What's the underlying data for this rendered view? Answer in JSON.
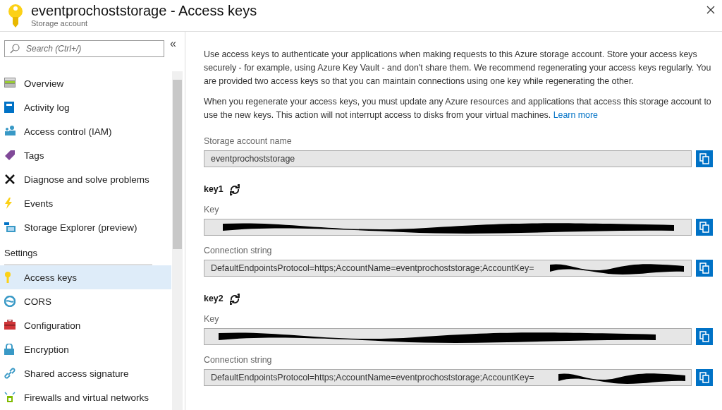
{
  "header": {
    "title": "eventprochoststorage - Access keys",
    "subtitle": "Storage account"
  },
  "sidebar": {
    "search": {
      "placeholder": "Search (Ctrl+/)"
    },
    "collapse": "«",
    "items": [
      {
        "label": "Overview",
        "selected": false
      },
      {
        "label": "Activity log",
        "selected": false
      },
      {
        "label": "Access control (IAM)",
        "selected": false
      },
      {
        "label": "Tags",
        "selected": false
      },
      {
        "label": "Diagnose and solve problems",
        "selected": false
      },
      {
        "label": "Events",
        "selected": false
      },
      {
        "label": "Storage Explorer (preview)",
        "selected": false
      }
    ],
    "sections": [
      {
        "title": "Settings",
        "items": [
          {
            "label": "Access keys",
            "selected": true
          },
          {
            "label": "CORS",
            "selected": false
          },
          {
            "label": "Configuration",
            "selected": false
          },
          {
            "label": "Encryption",
            "selected": false
          },
          {
            "label": "Shared access signature",
            "selected": false
          },
          {
            "label": "Firewalls and virtual networks",
            "selected": false
          }
        ]
      }
    ]
  },
  "content": {
    "paragraphs": [
      {
        "text": "Use access keys to authenticate your applications when making requests to this Azure storage account. Store your access keys securely - for example, using Azure Key Vault - and don't share them. We recommend regenerating your access keys regularly. You are provided two access keys so that you can maintain connections using one key while regenerating the other."
      },
      {
        "text": "When you regenerate your access keys, you must update any Azure resources and applications that access this storage account to use the new keys. This action will not interrupt access to disks from your virtual machines.",
        "link": "Learn more"
      }
    ],
    "account_name": {
      "label": "Storage account name",
      "value": "eventprochoststorage"
    },
    "keys": [
      {
        "title": "key1",
        "key_label": "Key",
        "connection_label": "Connection string",
        "connection_value": "DefaultEndpointsProtocol=https;AccountName=eventprochoststorage;AccountKey="
      },
      {
        "title": "key2",
        "key_label": "Key",
        "connection_label": "Connection string",
        "connection_value": "DefaultEndpointsProtocol=https;AccountName=eventprochoststorage;AccountKey="
      }
    ]
  }
}
